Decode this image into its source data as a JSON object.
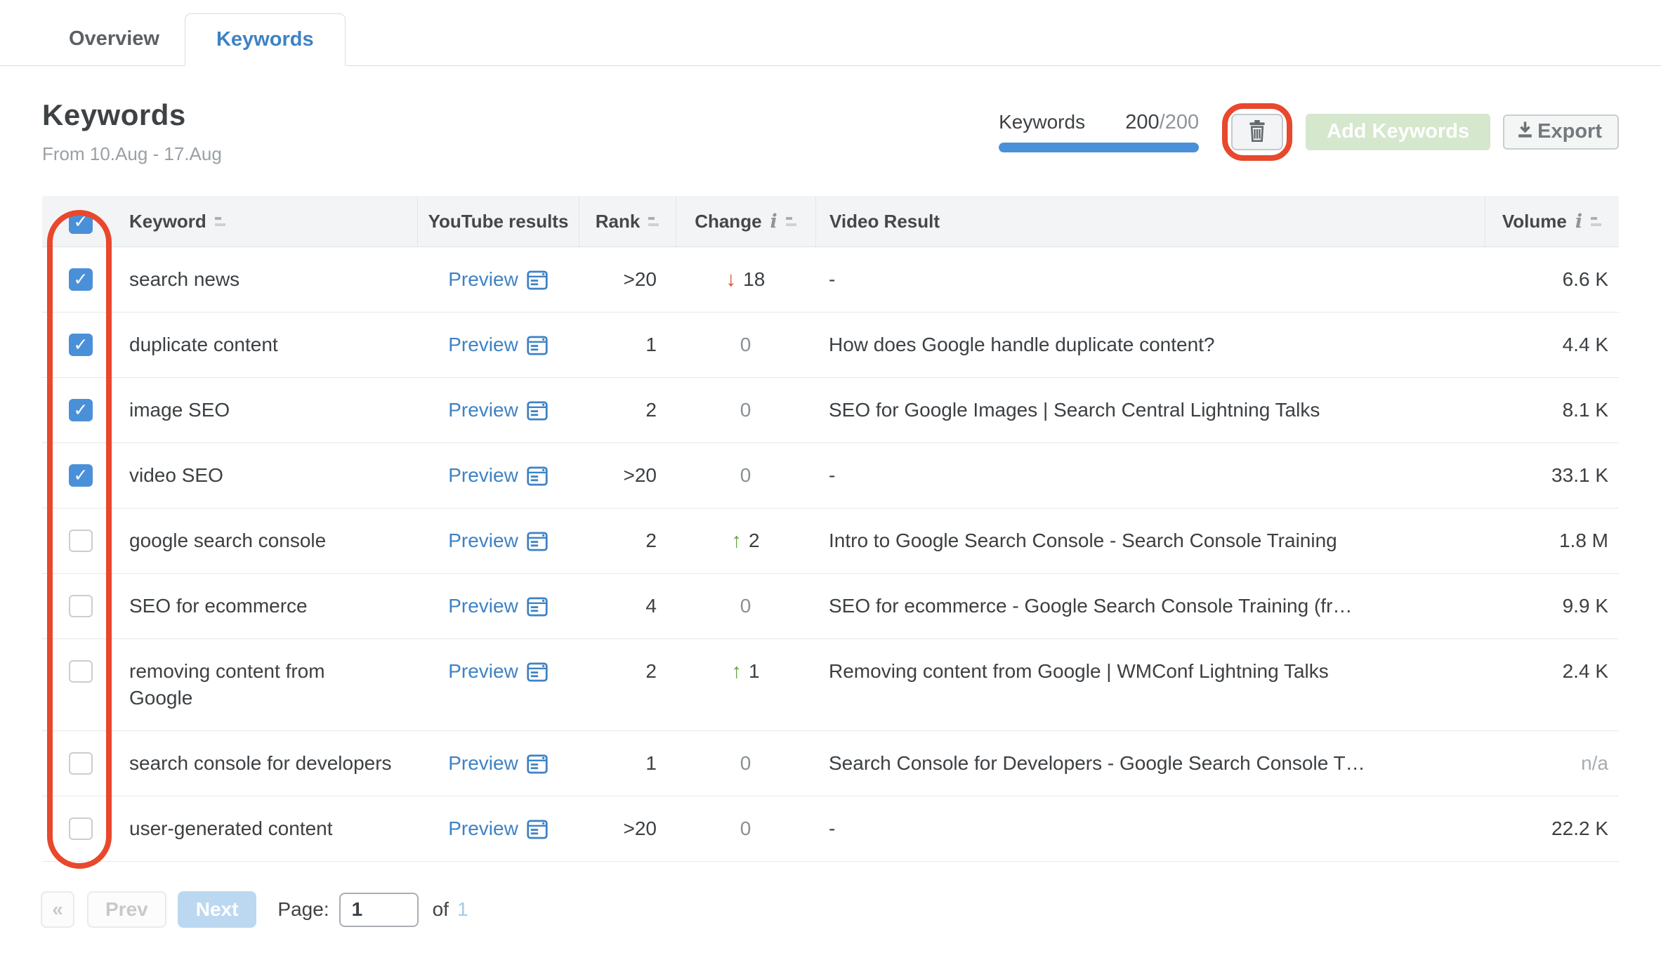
{
  "tabs": [
    {
      "label": "Overview",
      "active": false
    },
    {
      "label": "Keywords",
      "active": true
    }
  ],
  "header": {
    "title": "Keywords",
    "date_range": "From 10.Aug - 17.Aug"
  },
  "toolbar": {
    "counter_label": "Keywords",
    "counter_used": "200",
    "counter_total": "/200",
    "progress_color": "#4a90d9",
    "delete_icon": "trash-icon",
    "add_keywords_label": "Add Keywords",
    "export_label": "Export",
    "export_icon": "download-icon"
  },
  "annotations": {
    "color": "#e8482c",
    "items": [
      "checkbox-column-highlight",
      "delete-button-highlight"
    ]
  },
  "table": {
    "columns": {
      "checkbox": "",
      "keyword": "Keyword",
      "youtube_results": "YouTube results",
      "rank": "Rank",
      "change": "Change",
      "video_result": "Video Result",
      "volume": "Volume"
    },
    "rows": [
      {
        "checked": true,
        "keyword": "search news",
        "preview_label": "Preview",
        "rank": ">20",
        "change": {
          "dir": "down",
          "value": "18"
        },
        "video_result": "-",
        "volume": "6.6 K",
        "volume_muted": false
      },
      {
        "checked": true,
        "keyword": "duplicate content",
        "preview_label": "Preview",
        "rank": "1",
        "change": {
          "dir": "none",
          "value": "0"
        },
        "video_result": "How does Google handle duplicate content?",
        "volume": "4.4 K",
        "volume_muted": false
      },
      {
        "checked": true,
        "keyword": "image SEO",
        "preview_label": "Preview",
        "rank": "2",
        "change": {
          "dir": "none",
          "value": "0"
        },
        "video_result": "SEO for Google Images | Search Central Lightning Talks",
        "volume": "8.1 K",
        "volume_muted": false
      },
      {
        "checked": true,
        "keyword": "video SEO",
        "preview_label": "Preview",
        "rank": ">20",
        "change": {
          "dir": "none",
          "value": "0"
        },
        "video_result": "-",
        "volume": "33.1 K",
        "volume_muted": false
      },
      {
        "checked": false,
        "keyword": "google search console",
        "preview_label": "Preview",
        "rank": "2",
        "change": {
          "dir": "up",
          "value": "2"
        },
        "video_result": "Intro to Google Search Console - Search Console Training",
        "volume": "1.8 M",
        "volume_muted": false
      },
      {
        "checked": false,
        "keyword": "SEO for ecommerce",
        "preview_label": "Preview",
        "rank": "4",
        "change": {
          "dir": "none",
          "value": "0"
        },
        "video_result": "SEO for ecommerce - Google Search Console Training (fr…",
        "volume": "9.9 K",
        "volume_muted": false
      },
      {
        "checked": false,
        "keyword": "removing content from\nGoogle",
        "preview_label": "Preview",
        "rank": "2",
        "change": {
          "dir": "up",
          "value": "1"
        },
        "video_result": "Removing content from Google | WMConf Lightning Talks",
        "volume": "2.4 K",
        "volume_muted": false
      },
      {
        "checked": false,
        "keyword": "search console for developers",
        "preview_label": "Preview",
        "rank": "1",
        "change": {
          "dir": "none",
          "value": "0"
        },
        "video_result": "Search Console for Developers - Google Search Console T…",
        "volume": "n/a",
        "volume_muted": true
      },
      {
        "checked": false,
        "keyword": "user-generated content",
        "preview_label": "Preview",
        "rank": ">20",
        "change": {
          "dir": "none",
          "value": "0"
        },
        "video_result": "-",
        "volume": "22.2 K",
        "volume_muted": false
      }
    ]
  },
  "pagination": {
    "first_label": "«",
    "prev_label": "Prev",
    "next_label": "Next",
    "page_label": "Page:",
    "page_value": "1",
    "of_label": "of",
    "total_pages": "1"
  }
}
